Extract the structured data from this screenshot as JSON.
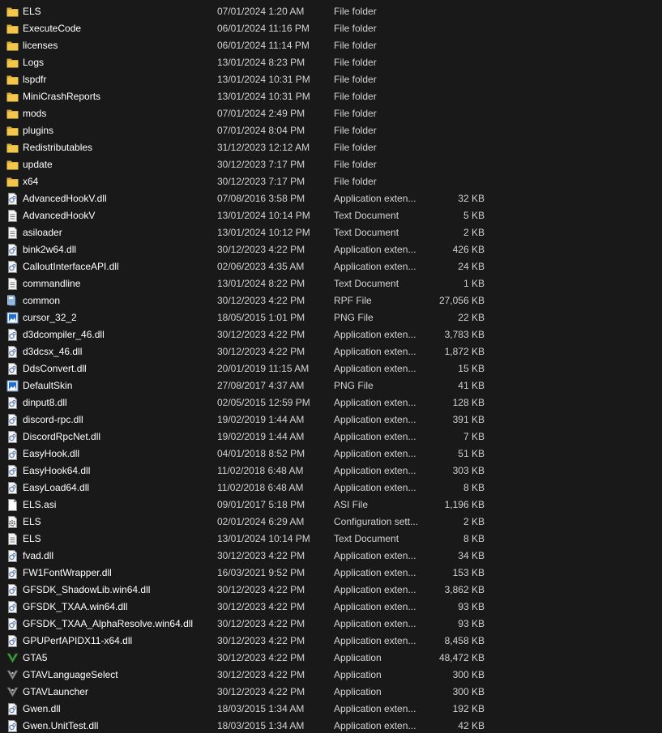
{
  "colors": {
    "background": "#191919",
    "folder": "#f3c64c",
    "folder_dark": "#d9a93a",
    "text": "#ffffff",
    "secondary_text": "#d2d2d2"
  },
  "files": [
    {
      "name": "ELS",
      "date": "07/01/2024 1:20 AM",
      "type": "File folder",
      "size": "",
      "icon": "folder-icon"
    },
    {
      "name": "ExecuteCode",
      "date": "06/01/2024 11:16 PM",
      "type": "File folder",
      "size": "",
      "icon": "folder-icon"
    },
    {
      "name": "licenses",
      "date": "06/01/2024 11:14 PM",
      "type": "File folder",
      "size": "",
      "icon": "folder-icon"
    },
    {
      "name": "Logs",
      "date": "13/01/2024 8:23 PM",
      "type": "File folder",
      "size": "",
      "icon": "folder-icon"
    },
    {
      "name": "lspdfr",
      "date": "13/01/2024 10:31 PM",
      "type": "File folder",
      "size": "",
      "icon": "folder-icon"
    },
    {
      "name": "MiniCrashReports",
      "date": "13/01/2024 10:31 PM",
      "type": "File folder",
      "size": "",
      "icon": "folder-icon"
    },
    {
      "name": "mods",
      "date": "07/01/2024 2:49 PM",
      "type": "File folder",
      "size": "",
      "icon": "folder-icon"
    },
    {
      "name": "plugins",
      "date": "07/01/2024 8:04 PM",
      "type": "File folder",
      "size": "",
      "icon": "folder-icon"
    },
    {
      "name": "Redistributables",
      "date": "31/12/2023 12:12 AM",
      "type": "File folder",
      "size": "",
      "icon": "folder-icon"
    },
    {
      "name": "update",
      "date": "30/12/2023 7:17 PM",
      "type": "File folder",
      "size": "",
      "icon": "folder-icon"
    },
    {
      "name": "x64",
      "date": "30/12/2023 7:17 PM",
      "type": "File folder",
      "size": "",
      "icon": "folder-icon"
    },
    {
      "name": "AdvancedHookV.dll",
      "date": "07/08/2016 3:58 PM",
      "type": "Application exten...",
      "size": "32 KB",
      "icon": "dll-file-icon"
    },
    {
      "name": "AdvancedHookV",
      "date": "13/01/2024 10:14 PM",
      "type": "Text Document",
      "size": "5 KB",
      "icon": "text-document-icon"
    },
    {
      "name": "asiloader",
      "date": "13/01/2024 10:12 PM",
      "type": "Text Document",
      "size": "2 KB",
      "icon": "text-document-icon"
    },
    {
      "name": "bink2w64.dll",
      "date": "30/12/2023 4:22 PM",
      "type": "Application exten...",
      "size": "426 KB",
      "icon": "dll-file-icon"
    },
    {
      "name": "CalloutInterfaceAPI.dll",
      "date": "02/06/2023 4:35 AM",
      "type": "Application exten...",
      "size": "24 KB",
      "icon": "dll-file-icon"
    },
    {
      "name": "commandline",
      "date": "13/01/2024 8:22 PM",
      "type": "Text Document",
      "size": "1 KB",
      "icon": "text-document-icon"
    },
    {
      "name": "common",
      "date": "30/12/2023 4:22 PM",
      "type": "RPF File",
      "size": "27,056 KB",
      "icon": "rpf-file-icon"
    },
    {
      "name": "cursor_32_2",
      "date": "18/05/2015 1:01 PM",
      "type": "PNG File",
      "size": "22 KB",
      "icon": "png-file-icon"
    },
    {
      "name": "d3dcompiler_46.dll",
      "date": "30/12/2023 4:22 PM",
      "type": "Application exten...",
      "size": "3,783 KB",
      "icon": "dll-file-icon"
    },
    {
      "name": "d3dcsx_46.dll",
      "date": "30/12/2023 4:22 PM",
      "type": "Application exten...",
      "size": "1,872 KB",
      "icon": "dll-file-icon"
    },
    {
      "name": "DdsConvert.dll",
      "date": "20/01/2019 11:15 AM",
      "type": "Application exten...",
      "size": "15 KB",
      "icon": "dll-file-icon"
    },
    {
      "name": "DefaultSkin",
      "date": "27/08/2017 4:37 AM",
      "type": "PNG File",
      "size": "41 KB",
      "icon": "png-file-icon"
    },
    {
      "name": "dinput8.dll",
      "date": "02/05/2015 12:59 PM",
      "type": "Application exten...",
      "size": "128 KB",
      "icon": "dll-file-icon"
    },
    {
      "name": "discord-rpc.dll",
      "date": "19/02/2019 1:44 AM",
      "type": "Application exten...",
      "size": "391 KB",
      "icon": "dll-file-icon"
    },
    {
      "name": "DiscordRpcNet.dll",
      "date": "19/02/2019 1:44 AM",
      "type": "Application exten...",
      "size": "7 KB",
      "icon": "dll-file-icon"
    },
    {
      "name": "EasyHook.dll",
      "date": "04/01/2018 8:52 PM",
      "type": "Application exten...",
      "size": "51 KB",
      "icon": "dll-file-icon"
    },
    {
      "name": "EasyHook64.dll",
      "date": "11/02/2018 6:48 AM",
      "type": "Application exten...",
      "size": "303 KB",
      "icon": "dll-file-icon"
    },
    {
      "name": "EasyLoad64.dll",
      "date": "11/02/2018 6:48 AM",
      "type": "Application exten...",
      "size": "8 KB",
      "icon": "dll-file-icon"
    },
    {
      "name": "ELS.asi",
      "date": "09/01/2017 5:18 PM",
      "type": "ASI File",
      "size": "1,196 KB",
      "icon": "blank-file-icon"
    },
    {
      "name": "ELS",
      "date": "02/01/2024 6:29 AM",
      "type": "Configuration sett...",
      "size": "2 KB",
      "icon": "config-file-icon"
    },
    {
      "name": "ELS",
      "date": "13/01/2024 10:14 PM",
      "type": "Text Document",
      "size": "8 KB",
      "icon": "text-document-icon"
    },
    {
      "name": "fvad.dll",
      "date": "30/12/2023 4:22 PM",
      "type": "Application exten...",
      "size": "34 KB",
      "icon": "dll-file-icon"
    },
    {
      "name": "FW1FontWrapper.dll",
      "date": "16/03/2021 9:52 PM",
      "type": "Application exten...",
      "size": "153 KB",
      "icon": "dll-file-icon"
    },
    {
      "name": "GFSDK_ShadowLib.win64.dll",
      "date": "30/12/2023 4:22 PM",
      "type": "Application exten...",
      "size": "3,862 KB",
      "icon": "dll-file-icon"
    },
    {
      "name": "GFSDK_TXAA.win64.dll",
      "date": "30/12/2023 4:22 PM",
      "type": "Application exten...",
      "size": "93 KB",
      "icon": "dll-file-icon"
    },
    {
      "name": "GFSDK_TXAA_AlphaResolve.win64.dll",
      "date": "30/12/2023 4:22 PM",
      "type": "Application exten...",
      "size": "93 KB",
      "icon": "dll-file-icon"
    },
    {
      "name": "GPUPerfAPIDX11-x64.dll",
      "date": "30/12/2023 4:22 PM",
      "type": "Application exten...",
      "size": "8,458 KB",
      "icon": "dll-file-icon"
    },
    {
      "name": "GTA5",
      "date": "30/12/2023 4:22 PM",
      "type": "Application",
      "size": "48,472 KB",
      "icon": "gta5-app-icon"
    },
    {
      "name": "GTAVLanguageSelect",
      "date": "30/12/2023 4:22 PM",
      "type": "Application",
      "size": "300 KB",
      "icon": "gta-launcher-app-icon"
    },
    {
      "name": "GTAVLauncher",
      "date": "30/12/2023 4:22 PM",
      "type": "Application",
      "size": "300 KB",
      "icon": "gta-launcher-app-icon"
    },
    {
      "name": "Gwen.dll",
      "date": "18/03/2015 1:34 AM",
      "type": "Application exten...",
      "size": "192 KB",
      "icon": "dll-file-icon"
    },
    {
      "name": "Gwen.UnitTest.dll",
      "date": "18/03/2015 1:34 AM",
      "type": "Application exten...",
      "size": "42 KB",
      "icon": "dll-file-icon"
    }
  ]
}
